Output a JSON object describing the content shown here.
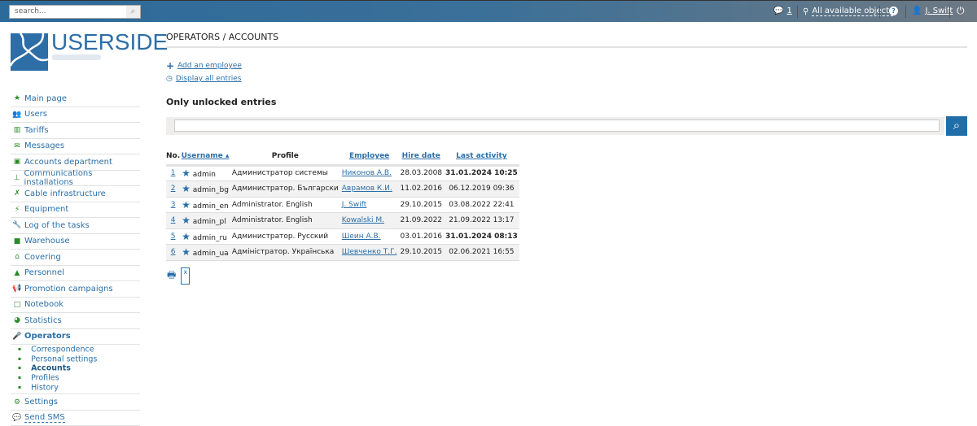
{
  "header": {
    "search_placeholder": "search...",
    "messages_count": "1",
    "objects_label": "All available objects",
    "help": "?",
    "user": "J. Swift"
  },
  "logo": {
    "text": "USERSIDE"
  },
  "sidebar": {
    "items": [
      {
        "label": "Main page",
        "icon": "★"
      },
      {
        "label": "Users",
        "icon": "👥"
      },
      {
        "label": "Tariffs",
        "icon": "▥"
      },
      {
        "label": "Messages",
        "icon": "✉"
      },
      {
        "label": "Accounts department",
        "icon": "▣"
      },
      {
        "label": "Communications installations",
        "icon": "⊥"
      },
      {
        "label": "Cable infrastructure",
        "icon": "✗"
      },
      {
        "label": "Equipment",
        "icon": "⚡"
      },
      {
        "label": "Log of the tasks",
        "icon": "🔧"
      },
      {
        "label": "Warehouse",
        "icon": "■"
      },
      {
        "label": "Covering",
        "icon": "⌂"
      },
      {
        "label": "Personnel",
        "icon": "▲"
      },
      {
        "label": "Promotion campaigns",
        "icon": "📢"
      },
      {
        "label": "Notebook",
        "icon": "□"
      },
      {
        "label": "Statistics",
        "icon": "◕"
      },
      {
        "label": "Operators",
        "icon": "🎤"
      }
    ],
    "subitems": [
      "Correspondence",
      "Personal settings",
      "Accounts",
      "Profiles",
      "History"
    ],
    "bottom": [
      {
        "label": "Settings",
        "icon": "⚙"
      },
      {
        "label": "Send SMS",
        "icon": "💬"
      }
    ]
  },
  "main": {
    "title": "OPERATORS / ACCOUNTS",
    "add_employee": "Add an employee",
    "display_all": "Display all entries",
    "subtitle": "Only unlocked entries",
    "table": {
      "headers": [
        "No.",
        "Username ▴",
        "Profile",
        "Employee",
        "Hire date",
        "Last activity"
      ],
      "rows": [
        {
          "no": "1",
          "username": "admin",
          "profile": "Администратор системы",
          "employee": "Никонов А.В.",
          "hire": "28.03.2008",
          "last": "31.01.2024 10:25",
          "bold": true
        },
        {
          "no": "2",
          "username": "admin_bg",
          "profile": "Администратор. Български",
          "employee": "Аврамов К.И.",
          "hire": "11.02.2016",
          "last": "06.12.2019 09:36",
          "bold": false
        },
        {
          "no": "3",
          "username": "admin_en",
          "profile": "Administrator. English",
          "employee": "J. Swift",
          "hire": "29.10.2015",
          "last": "03.08.2022 22:41",
          "bold": false
        },
        {
          "no": "4",
          "username": "admin_pl",
          "profile": "Administrator. English",
          "employee": "Kowalski M.",
          "hire": "21.09.2022",
          "last": "21.09.2022 13:17",
          "bold": false
        },
        {
          "no": "5",
          "username": "admin_ru",
          "profile": "Администратор. Русский",
          "employee": "Шеин А.В.",
          "hire": "03.01.2016",
          "last": "31.01.2024 08:13",
          "bold": true
        },
        {
          "no": "6",
          "username": "admin_ua",
          "profile": "Адміністратор. Українська",
          "employee": "Шевченко Т.Г.",
          "hire": "29.10.2015",
          "last": "02.06.2021 16:55",
          "bold": false
        }
      ]
    }
  }
}
